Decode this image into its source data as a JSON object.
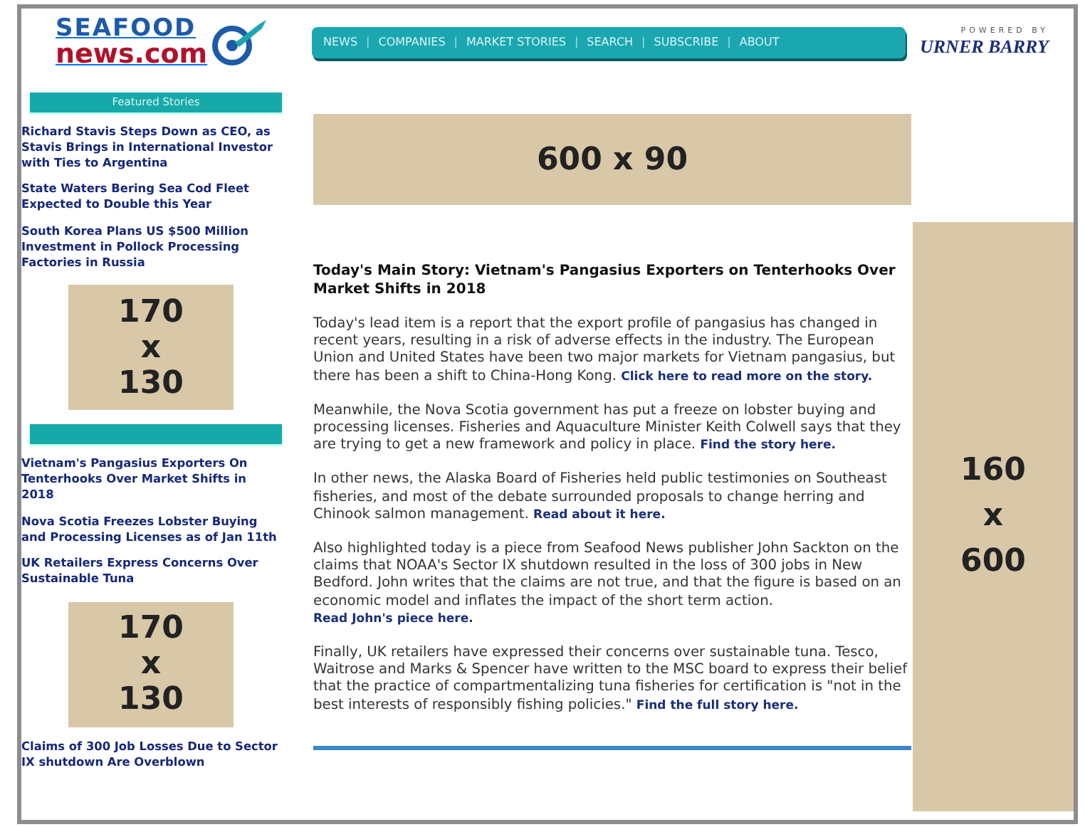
{
  "logo": {
    "top": "SEAFOOD",
    "bottom": "news.com"
  },
  "nav": [
    {
      "kind": "link",
      "label": "NEWS"
    },
    {
      "kind": "separator",
      "label": "|"
    },
    {
      "kind": "link",
      "label": "COMPANIES"
    },
    {
      "kind": "separator",
      "label": "|"
    },
    {
      "kind": "link",
      "label": "MARKET STORIES"
    },
    {
      "kind": "separator",
      "label": "|"
    },
    {
      "kind": "link",
      "label": "SEARCH"
    },
    {
      "kind": "separator",
      "label": "|"
    },
    {
      "kind": "link",
      "label": "SUBSCRIBE"
    },
    {
      "kind": "separator",
      "label": "|"
    },
    {
      "kind": "link",
      "label": "ABOUT"
    }
  ],
  "powered_by": {
    "caption": "POWERED BY",
    "brand": "URNER BARRY"
  },
  "sidebar": [
    {
      "kind": "heading",
      "label": "Featured Stories"
    },
    {
      "kind": "story",
      "label": "Richard Stavis Steps Down as CEO, as Stavis Brings in International Investor with Ties to Argentina"
    },
    {
      "kind": "story",
      "label": "State Waters Bering Sea Cod Fleet Expected to Double this Year"
    },
    {
      "kind": "story",
      "label": "South Korea Plans US $500 Million Investment in Pollock Processing Factories in Russia"
    },
    {
      "kind": "ad",
      "lines": [
        "170",
        "x",
        "130"
      ]
    },
    {
      "kind": "heading"
    },
    {
      "kind": "story",
      "label": "Vietnam's Pangasius Exporters On Tenterhooks Over Market Shifts in 2018"
    },
    {
      "kind": "story",
      "label": "Nova Scotia Freezes Lobster Buying and Processing Licenses as of Jan 11th"
    },
    {
      "kind": "story",
      "label": "UK Retailers Express Concerns Over Sustainable Tuna"
    },
    {
      "kind": "ad",
      "lines": [
        "170",
        "x",
        "130"
      ]
    },
    {
      "kind": "story",
      "label": "Claims of 300 Job Losses Due to Sector IX shutdown Are Overblown"
    }
  ],
  "top_ad": {
    "lines": [
      "600 x 90"
    ]
  },
  "side_ad": {
    "lines": [
      "160",
      "x",
      "600"
    ]
  },
  "main_story": {
    "title": "Today's Main Story: Vietnam's Pangasius Exporters on Tenterhooks Over Market Shifts in 2018",
    "paragraphs": [
      {
        "text": "Today's lead item is a report that the export profile of pangasius has changed in recent years, resulting in a risk of adverse effects in the industry. The European Union and United States have been two major markets for Vietnam pangasius, but there has been a shift to China-Hong Kong.",
        "link": "Click here to read more on the story."
      },
      {
        "text": "Meanwhile, the Nova Scotia government has put a freeze on lobster buying and processing licenses. Fisheries and Aquaculture Minister Keith Colwell says that they are trying to get a new framework and policy in place.",
        "link": "Find the story here."
      },
      {
        "text": "In other news, the Alaska Board of Fisheries held public testimonies on Southeast fisheries, and most of the debate surrounded proposals to change herring and Chinook salmon management.",
        "link": "Read about it here."
      },
      {
        "text": "Also highlighted today is a piece from Seafood News publisher John Sackton on the claims that NOAA's Sector IX shutdown resulted in the loss of 300 jobs in New Bedford. John writes that the claims are not true, and that the figure is based on an economic model and inflates the impact of the short term action.",
        "link": "Read John's piece here."
      },
      {
        "text": "Finally, UK retailers have expressed their concerns over sustainable tuna. Tesco, Waitrose and Marks & Spencer have written to the MSC board to express their belief that the practice of compartmentalizing tuna fisheries for certification is \"not in the best interests of responsibly fishing policies.\"",
        "link": "Find the full story here."
      }
    ]
  }
}
